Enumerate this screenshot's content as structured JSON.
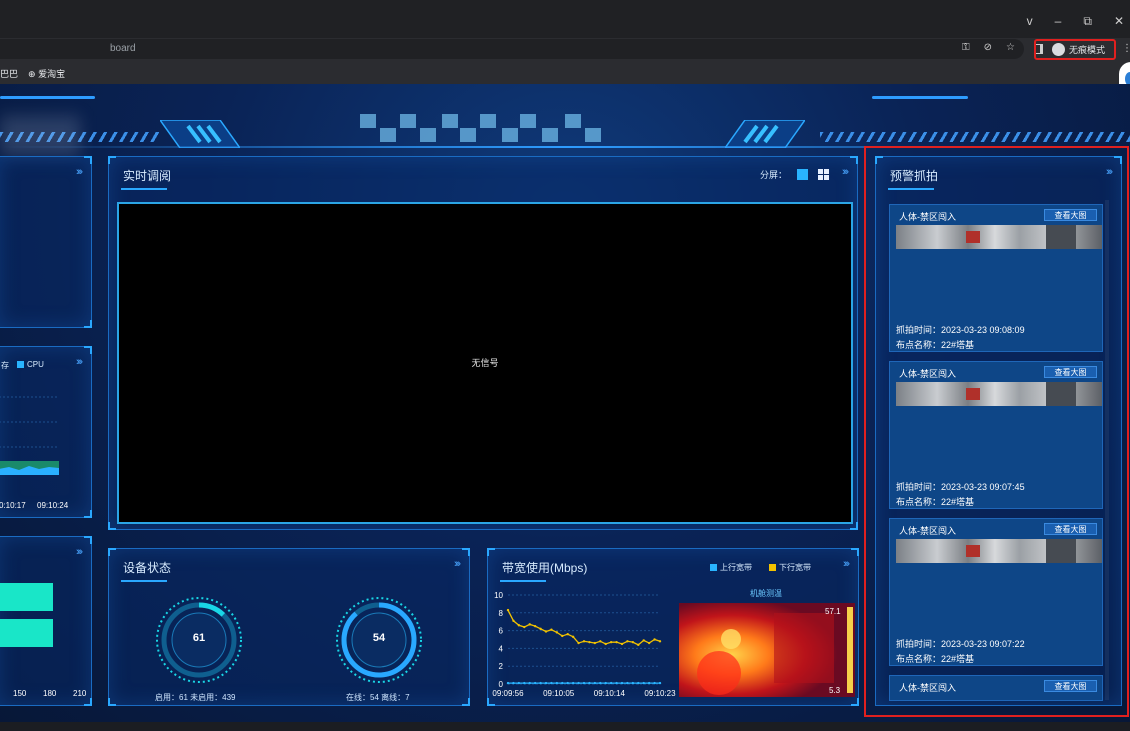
{
  "browser": {
    "url_fragment": "board",
    "incognito_label": "无痕模式",
    "bookmarks": [
      "巴巴",
      "爱淘宝"
    ],
    "window_controls": [
      "v",
      "–",
      "⧉",
      "✕"
    ]
  },
  "dashboard": {
    "colors": {
      "accent": "#2aa8ff",
      "alert_outline": "#e0201f",
      "card_bg": "#0e4687",
      "bar_fill": "#19e6c8",
      "upload": "#29b4ff",
      "download": "#f2c200"
    },
    "video_panel": {
      "title": "实时调阅",
      "split_label": "分屏：",
      "no_signal": "无信号"
    },
    "left_mid_panel": {
      "legend": [
        "存",
        "CPU"
      ],
      "times": [
        "0:10:17",
        "09:10:24"
      ]
    },
    "left_bottom_panel": {
      "ticks": [
        "150",
        "180",
        "210"
      ]
    },
    "device_panel": {
      "title": "设备状态",
      "gauge_enabled": {
        "value": "61",
        "stat": "启用：61 未启用：439",
        "fraction": 0.122
      },
      "gauge_online": {
        "value": "54",
        "stat": "在线：54 离线：7",
        "fraction": 0.885
      }
    },
    "bandwidth_panel": {
      "title": "带宽使用(Mbps)",
      "legend_up": "上行宽带",
      "legend_down": "下行宽带",
      "thermal_title": "机舱测温",
      "thermal_max": "57.1",
      "thermal_min": "5.3"
    },
    "alert_panel": {
      "title": "预警抓拍",
      "cards": [
        {
          "title": "人体-禁区闯入",
          "button": "查看大图",
          "time": "抓拍时间：2023-03-23 09:08:09",
          "site": "布点名称：22#塔基"
        },
        {
          "title": "人体-禁区闯入",
          "button": "查看大图",
          "time": "抓拍时间：2023-03-23 09:07:45",
          "site": "布点名称：22#塔基"
        },
        {
          "title": "人体-禁区闯入",
          "button": "查看大图",
          "time": "抓拍时间：2023-03-23 09:07:22",
          "site": "布点名称：22#塔基"
        },
        {
          "title": "人体-禁区闯入",
          "button": "查看大图"
        }
      ]
    }
  },
  "chart_data": {
    "type": "line",
    "ylim": [
      0,
      10
    ],
    "yticks": [
      "0",
      "2",
      "4",
      "6",
      "8",
      "10"
    ],
    "x_ticks": [
      "09:09:56",
      "09:10:05",
      "09:10:14",
      "09:10:23"
    ],
    "series": [
      {
        "name": "上行宽带",
        "values": [
          0.1,
          0.1,
          0.1,
          0.1,
          0.1,
          0.1,
          0.1,
          0.1,
          0.1,
          0.1,
          0.1,
          0.1,
          0.1,
          0.1,
          0.1,
          0.1,
          0.1,
          0.1,
          0.1,
          0.1,
          0.1,
          0.1,
          0.1,
          0.1,
          0.1,
          0.1,
          0.1,
          0.1,
          0.1
        ]
      },
      {
        "name": "下行宽带",
        "values": [
          8.3,
          7.1,
          6.6,
          6.4,
          6.7,
          6.5,
          6.2,
          5.9,
          6.1,
          5.8,
          5.4,
          5.6,
          5.3,
          4.6,
          4.8,
          4.7,
          4.6,
          4.8,
          4.5,
          4.7,
          4.7,
          4.5,
          4.8,
          4.7,
          4.4,
          4.9,
          4.6,
          5.0,
          4.8
        ]
      }
    ]
  }
}
